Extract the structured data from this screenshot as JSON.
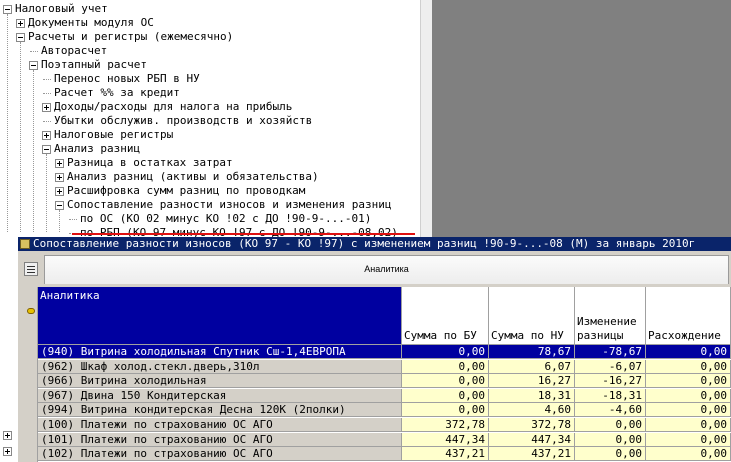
{
  "tree": {
    "nodes": [
      {
        "label": "Налоговый учет",
        "expander": "minus",
        "depth": 0
      },
      {
        "label": "Документы модуля ОС",
        "expander": "plus",
        "depth": 1
      },
      {
        "label": "Расчеты и регистры (ежемесячно)",
        "expander": "minus",
        "depth": 1
      },
      {
        "label": "Авторасчет",
        "expander": "none",
        "depth": 2
      },
      {
        "label": "Поэтапный расчет",
        "expander": "minus",
        "depth": 2
      },
      {
        "label": "Перенос новых РБП в НУ",
        "expander": "none",
        "depth": 3
      },
      {
        "label": "Расчет %% за кредит",
        "expander": "none",
        "depth": 3
      },
      {
        "label": "Доходы/расходы для налога на прибыль",
        "expander": "plus",
        "depth": 3
      },
      {
        "label": "Убытки обслужив. производств и хозяйств",
        "expander": "none",
        "depth": 3
      },
      {
        "label": "Налоговые регистры",
        "expander": "plus",
        "depth": 3
      },
      {
        "label": "Анализ разниц",
        "expander": "minus",
        "depth": 3
      },
      {
        "label": "Разница в остатках затрат",
        "expander": "plus",
        "depth": 4
      },
      {
        "label": "Анализ разниц (активы и обязательства)",
        "expander": "plus",
        "depth": 4
      },
      {
        "label": "Расшифровка сумм разниц по проводкам",
        "expander": "plus",
        "depth": 4
      },
      {
        "label": "Сопоставление разности износов и изменения разниц",
        "expander": "minus",
        "depth": 4
      },
      {
        "label": "по ОС (КО 02 минус КО !02 с ДО !90-9-...-01)",
        "expander": "none",
        "depth": 5
      },
      {
        "label": "по РБП (КО 97 минус КО !97 с ДО !90-9-...-08,02)",
        "expander": "none",
        "depth": 5
      }
    ]
  },
  "window": {
    "title": "Сопоставление разности износов (КО 97 - КО !97) с изменением разниц !90-9-...-08 (М)  за январь 2010г",
    "toolbar_label": "Аналитика",
    "columns": {
      "analytics": "Аналитика",
      "sum_bu": "Сумма по БУ",
      "sum_nu": "Сумма по НУ",
      "change": "Изменение разницы",
      "diff": "Расхождение"
    },
    "rows": [
      {
        "name": "(940) Витрина холодильная Спутник Сш-1,4ЕВРОПА",
        "bu": "0,00",
        "nu": "78,67",
        "change": "-78,67",
        "diff": "0,00",
        "selected": true
      },
      {
        "name": "(962) Шкаф холод.стекл.дверь,310л",
        "bu": "0,00",
        "nu": "6,07",
        "change": "-6,07",
        "diff": "0,00"
      },
      {
        "name": "(966) Витрина холодильная",
        "bu": "0,00",
        "nu": "16,27",
        "change": "-16,27",
        "diff": "0,00"
      },
      {
        "name": "(967) Двина 150 Кондитерская",
        "bu": "0,00",
        "nu": "18,31",
        "change": "-18,31",
        "diff": "0,00"
      },
      {
        "name": "(994) Витрина кондитерская Десна 120К (2полки)",
        "bu": "0,00",
        "nu": "4,60",
        "change": "-4,60",
        "diff": "0,00"
      },
      {
        "name": "(100) Платежи по страхованию ОС АГО",
        "bu": "372,78",
        "nu": "372,78",
        "change": "0,00",
        "diff": "0,00"
      },
      {
        "name": "(101) Платежи по страхованию ОС АГО",
        "bu": "447,34",
        "nu": "447,34",
        "change": "0,00",
        "diff": "0,00"
      },
      {
        "name": "(102) Платежи по страхованию ОС АГО",
        "bu": "437,21",
        "nu": "437,21",
        "change": "0,00",
        "diff": "0,00"
      }
    ]
  },
  "colors": {
    "selection": "#0000a0",
    "title_bar": "#0a246a",
    "number_cell": "#ffffcc",
    "underline": "#e01010"
  }
}
